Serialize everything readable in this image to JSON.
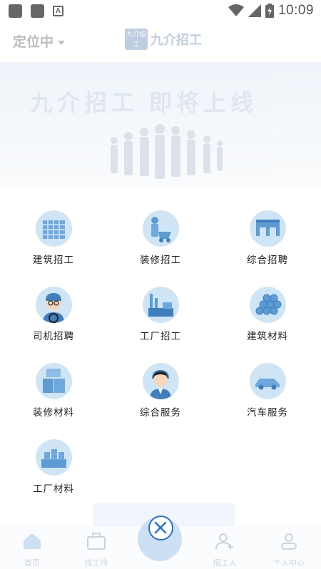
{
  "status_bar": {
    "time": "10:09",
    "notification_icons": [
      "app-icon",
      "app-icon",
      "a-icon"
    ],
    "status_icons": [
      "wifi-icon",
      "signal-icon",
      "battery-icon"
    ]
  },
  "header": {
    "location_label": "定位中",
    "logo_badge": "九介招工",
    "logo_text": "九介招工"
  },
  "banner": {
    "text": "九介招工 即将上线"
  },
  "categories": [
    {
      "label": "建筑招工",
      "icon": "building-construction-icon"
    },
    {
      "label": "装修招工",
      "icon": "decoration-worker-icon"
    },
    {
      "label": "综合招聘",
      "icon": "factory-building-icon"
    },
    {
      "label": "司机招聘",
      "icon": "driver-icon"
    },
    {
      "label": "工厂招工",
      "icon": "factory-icon"
    },
    {
      "label": "建筑材料",
      "icon": "pipes-icon"
    },
    {
      "label": "装修材料",
      "icon": "boxes-icon"
    },
    {
      "label": "综合服务",
      "icon": "customer-service-icon"
    },
    {
      "label": "汽车服务",
      "icon": "car-icon"
    },
    {
      "label": "工厂材料",
      "icon": "factory-materials-icon"
    }
  ],
  "tabbar": {
    "items": [
      {
        "label": "首页",
        "icon": "home-icon"
      },
      {
        "label": "找工作",
        "icon": "briefcase-icon"
      },
      {
        "label": "",
        "icon": "center-action-icon"
      },
      {
        "label": "招工人",
        "icon": "add-user-icon"
      },
      {
        "label": "个人中心",
        "icon": "profile-icon"
      }
    ]
  },
  "colors": {
    "accent": "#2b6fd6",
    "icon_bg": "#cfe5f5",
    "icon_main": "#5d9bd3"
  }
}
